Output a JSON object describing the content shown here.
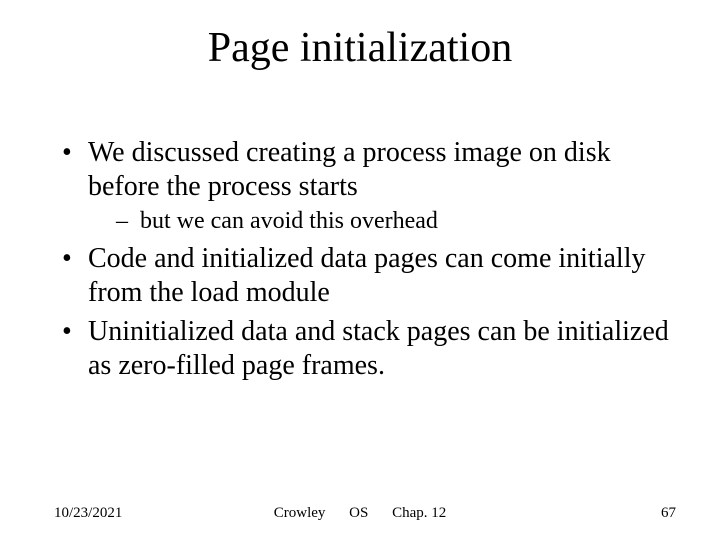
{
  "title": "Page initialization",
  "bullets": {
    "b1": "We discussed creating a process image on disk before the process starts",
    "b1_sub1": "but we can avoid this overhead",
    "b2": "Code and initialized data pages can come initially from the load module",
    "b3": "Uninitialized data and stack pages can be initialized as zero-filled page frames."
  },
  "footer": {
    "date": "10/23/2021",
    "author": "Crowley",
    "course": "OS",
    "chapter": "Chap. 12",
    "page": "67"
  }
}
